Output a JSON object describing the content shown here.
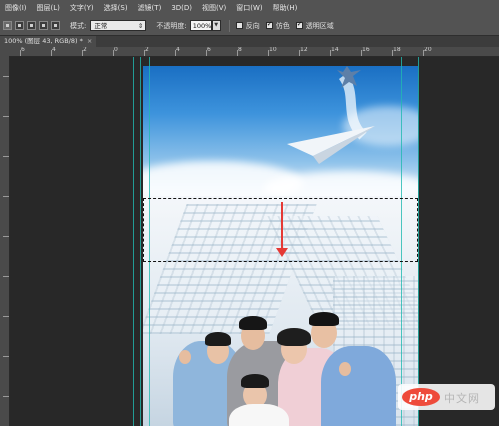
{
  "menu": {
    "items": [
      "图像(I)",
      "图层(L)",
      "文字(Y)",
      "选择(S)",
      "滤镜(T)",
      "3D(D)",
      "视图(V)",
      "窗口(W)",
      "帮助(H)"
    ]
  },
  "options": {
    "mode_label": "模式:",
    "mode_value": "正常",
    "opacity_label": "不透明度:",
    "opacity_value": "100%",
    "reverse_label": "反向",
    "dither_label": "仿色",
    "transparency_label": "透明区域",
    "reverse_checked": false,
    "dither_checked": true,
    "transparency_checked": true
  },
  "tab": {
    "title": "100% (图层 43, RGB/8) *",
    "close": "×"
  },
  "ruler": {
    "labels": [
      "6",
      "4",
      "2",
      "0",
      "2",
      "4",
      "6",
      "8",
      "10",
      "12",
      "14",
      "16",
      "18",
      "20"
    ]
  },
  "watermark": {
    "logo": "php",
    "text": "中文网"
  },
  "colors": {
    "guide": "#21b9b0",
    "arrow": "#e53935",
    "brand": "#ee4b3b"
  }
}
